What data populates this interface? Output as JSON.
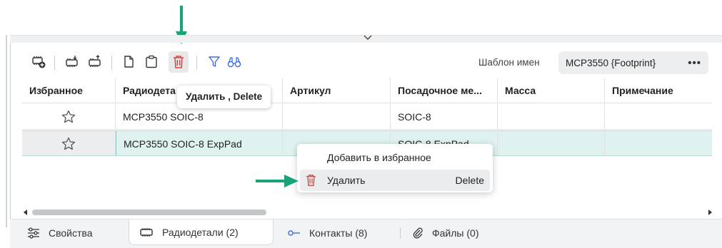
{
  "toolbar": {
    "template_label": "Шаблон имен",
    "template_value": "MCP3550 {Footprint}",
    "more_glyph": "•••",
    "buttons": [
      {
        "name": "add-component-button",
        "icon": "chip-add-icon"
      },
      {
        "name": "import-component-button",
        "icon": "chip-down-icon"
      },
      {
        "name": "export-component-button",
        "icon": "chip-up-icon"
      },
      {
        "name": "copy-button",
        "icon": "copy-icon"
      },
      {
        "name": "paste-button",
        "icon": "clipboard-icon"
      },
      {
        "name": "delete-button",
        "icon": "trash-icon"
      },
      {
        "name": "filter-button",
        "icon": "filter-icon"
      },
      {
        "name": "find-button",
        "icon": "binoculars-icon"
      }
    ]
  },
  "tooltip": {
    "text": "Удалить , Delete"
  },
  "table": {
    "headers": [
      "Избранное",
      "Радиодета",
      "Артикул",
      "Посадочное ме...",
      "Масса",
      "Примечание"
    ],
    "rows": [
      {
        "favorite": false,
        "name": "MCP3550 SOIC-8",
        "article": "",
        "footprint": "SOIC-8",
        "mass": "",
        "note": ""
      },
      {
        "favorite": false,
        "name": "MCP3550 SOIC-8 ExpPad",
        "article": "",
        "footprint": "SOIC-8 ExpPad",
        "mass": "",
        "note": "",
        "selected": true
      }
    ]
  },
  "context_menu": {
    "items": [
      {
        "label": "Добавить в избранное",
        "shortcut": "",
        "icon": ""
      },
      {
        "label": "Удалить",
        "shortcut": "Delete",
        "icon": "trash-icon",
        "highlighted": true
      }
    ]
  },
  "bottom_tabs": [
    {
      "label": "Свойства",
      "icon": "sliders-icon",
      "active": false
    },
    {
      "label": "Радиодетали (2)",
      "icon": "chip-icon",
      "active": true
    },
    {
      "label": "Контакты (8)",
      "icon": "pin-icon",
      "active": false
    },
    {
      "label": "Файлы (0)",
      "icon": "paperclip-icon",
      "active": false
    }
  ],
  "colors": {
    "annotation_arrow": "#1aa37a",
    "delete_red": "#d64541",
    "selection": "#dff2f0"
  }
}
